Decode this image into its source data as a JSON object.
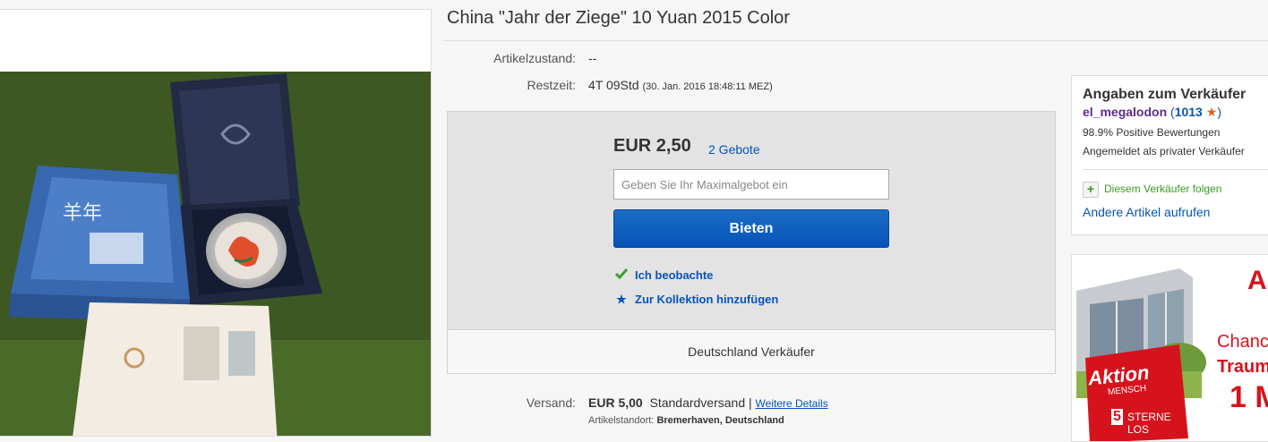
{
  "listing": {
    "title": "China \"Jahr der Ziege\" 10 Yuan 2015 Color"
  },
  "details": {
    "condition_label": "Artikelzustand:",
    "condition_value": "--",
    "time_label": "Restzeit:",
    "time_value": "4T 09Std",
    "time_end": "(30. Jan. 2016   18:48:11 MEZ)"
  },
  "bid": {
    "price": "EUR 2,50",
    "bids_link": "2 Gebote",
    "input_placeholder": "Geben Sie Ihr Maximalgebot ein",
    "button_label": "Bieten",
    "watch_label": "Ich beobachte",
    "collection_label": "Zur Kollektion hinzufügen",
    "seller_country": "Deutschland Verkäufer"
  },
  "shipping": {
    "label": "Versand:",
    "price": "EUR 5,00",
    "method": "Standardversand",
    "separator": "|",
    "more_link": "Weitere Details",
    "location_label": "Artikelstandort:",
    "location_value": "Bremerhaven, Deutschland"
  },
  "seller": {
    "heading": "Angaben zum Verkäufer",
    "name": "el_megalodon",
    "feedback_open": "(",
    "feedback_count": "1013",
    "feedback_close": ")",
    "positive": "98.9% Positive Bewertungen",
    "account_type": "Angemeldet als privater Verkäufer",
    "follow": "Diesem Verkäufer folgen",
    "other_items": "Andere Artikel aufrufen"
  },
  "ad": {
    "headline_partial": "A",
    "line1_partial": "Chanc",
    "line2_partial": "Traum",
    "line3_partial": "1 M",
    "badge_line1": "Aktion",
    "badge_line2": "MENSCH",
    "badge_number": "5",
    "badge_line3": "STERNE",
    "badge_line4": "LOS"
  },
  "colors": {
    "link_blue": "#0654ba",
    "button_blue": "#0654ba",
    "seller_purple": "#5d2b8e",
    "follow_green": "#3a9c1f",
    "ad_red": "#d6131c"
  },
  "icons": {
    "watch": "checkmark-icon",
    "collection": "star-icon",
    "feedback_star": "star-icon",
    "follow": "plus-icon"
  }
}
